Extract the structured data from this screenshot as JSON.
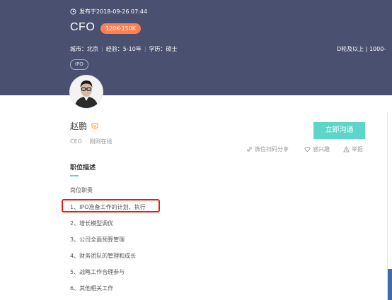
{
  "header": {
    "posted": "发布于2018-09-26 07:44",
    "title": "CFO",
    "salary": "120K-150K",
    "meta": {
      "city": "城市：北京",
      "experience": "经验：5-10年",
      "education": "学历：硕士"
    },
    "meta_right": "D轮及以上 | 1000-",
    "tag": "IPO",
    "background_color": "#4a5170",
    "salary_color": "#ff7f50"
  },
  "recruiter": {
    "name": "赵鹏",
    "title": "CEO",
    "status": "刚刚在线",
    "badge_icon": "verified-v-icon"
  },
  "actions": {
    "contact_button": "立即沟通",
    "share": "微信扫码分享",
    "interested": "感兴趣",
    "report": "举报",
    "accent_color": "#5dd5c8"
  },
  "job": {
    "section_title": "职位描述",
    "sub_title": "岗位职责",
    "duties": [
      "1、IPO准备工作的计划、执行",
      "2、增长模型调优",
      "3、公司全面预算管理",
      "4、财务团队的管理和成长",
      "5、战略工作合理参与",
      "6、其他相关工作"
    ]
  },
  "annotation": {
    "highlight_color": "#e0201f"
  }
}
